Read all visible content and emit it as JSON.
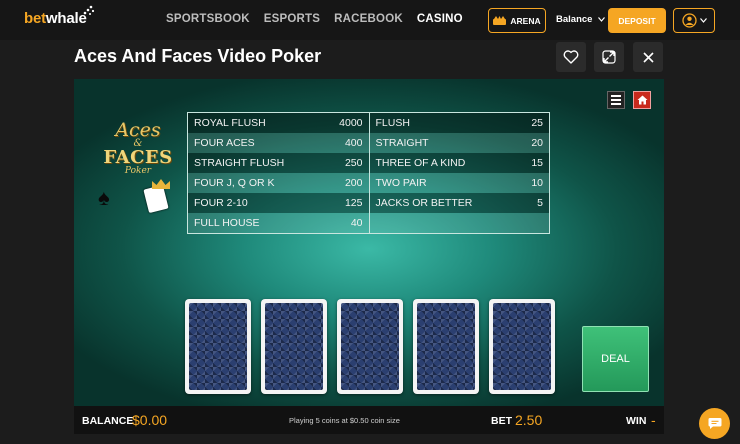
{
  "brand": {
    "bet": "bet",
    "whale": "whale"
  },
  "nav": {
    "links": [
      "SPORTSBOOK",
      "ESPORTS",
      "RACEBOOK",
      "CASINO"
    ]
  },
  "header": {
    "arena": "ARENA",
    "balance": "Balance",
    "deposit": "DEPOSIT"
  },
  "page": {
    "title": "Aces And Faces Video Poker"
  },
  "game_logo": {
    "line1": "Aces",
    "line2": "&",
    "line3": "FACES",
    "line4": "Poker"
  },
  "paytable": {
    "left": [
      {
        "hand": "ROYAL FLUSH",
        "payout": "4000"
      },
      {
        "hand": "FOUR ACES",
        "payout": "400"
      },
      {
        "hand": "STRAIGHT FLUSH",
        "payout": "250"
      },
      {
        "hand": "FOUR J, Q OR K",
        "payout": "200"
      },
      {
        "hand": "FOUR 2-10",
        "payout": "125"
      },
      {
        "hand": "FULL HOUSE",
        "payout": "40"
      }
    ],
    "right": [
      {
        "hand": "FLUSH",
        "payout": "25"
      },
      {
        "hand": "STRAIGHT",
        "payout": "20"
      },
      {
        "hand": "THREE OF A KIND",
        "payout": "15"
      },
      {
        "hand": "TWO PAIR",
        "payout": "10"
      },
      {
        "hand": "JACKS OR BETTER",
        "payout": "5"
      },
      {
        "hand": "",
        "payout": ""
      }
    ]
  },
  "controls": {
    "deal": "DEAL"
  },
  "bottom": {
    "balance_label": "BALANCE",
    "balance_value": "$0.00",
    "info": "Playing 5 coins at $0.50 coin size",
    "bet_label": "BET",
    "bet_value": "2.50",
    "win_label": "WIN",
    "win_value": "-"
  },
  "colors": {
    "accent": "#f5a623",
    "deal": "#2fae66",
    "table_bg": "#1f8a7b"
  },
  "icons": [
    "heart-icon",
    "expand-icon",
    "close-icon",
    "menu-icon",
    "home-icon",
    "chat-icon",
    "user-icon",
    "chevron-down-icon"
  ]
}
